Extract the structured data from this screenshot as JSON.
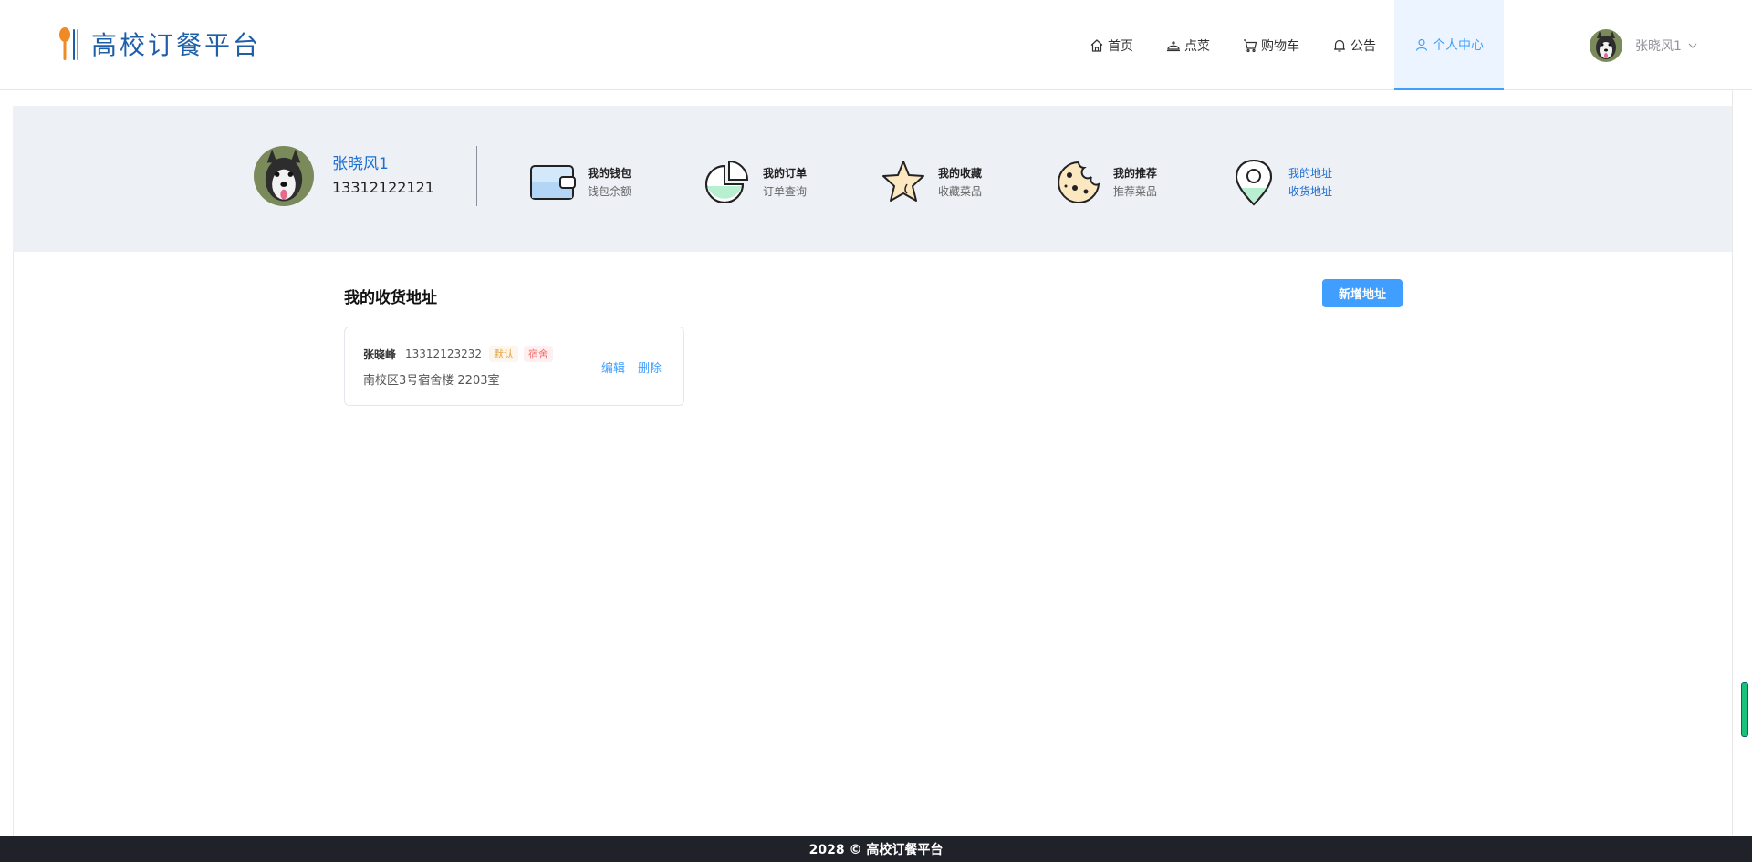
{
  "brand": {
    "name": "高校订餐平台"
  },
  "nav": {
    "items": [
      {
        "label": "首页",
        "icon": "home-icon"
      },
      {
        "label": "点菜",
        "icon": "dish-cover-icon"
      },
      {
        "label": "购物车",
        "icon": "cart-icon"
      },
      {
        "label": "公告",
        "icon": "bell-icon"
      },
      {
        "label": "个人中心",
        "icon": "user-icon",
        "active": true
      }
    ],
    "user_name": "张晓风1"
  },
  "profile": {
    "name": "张晓风1",
    "phone": "13312122121"
  },
  "features": [
    {
      "title": "我的钱包",
      "sub": "钱包余额",
      "icon": "wallet-icon"
    },
    {
      "title": "我的订单",
      "sub": "订单查询",
      "icon": "pie-chart-icon"
    },
    {
      "title": "我的收藏",
      "sub": "收藏菜品",
      "icon": "star-icon"
    },
    {
      "title": "我的推荐",
      "sub": "推荐菜品",
      "icon": "cookie-icon"
    },
    {
      "title": "我的地址",
      "sub": "收货地址",
      "icon": "location-pin-icon",
      "active": true
    }
  ],
  "main": {
    "title": "我的收货地址",
    "add_button": "新增地址"
  },
  "addresses": [
    {
      "name": "张晓峰",
      "phone": "13312123232",
      "tag_default": "默认",
      "tag_type": "宿舍",
      "detail": "南校区3号宿舍楼 2203室",
      "edit": "编辑",
      "delete": "删除"
    }
  ],
  "footer": {
    "text": "2028 © 高校订餐平台"
  },
  "colors": {
    "accent": "#409eff",
    "brand": "#1e5fa8",
    "band": "#edf0f5",
    "footer": "#1f2228"
  }
}
